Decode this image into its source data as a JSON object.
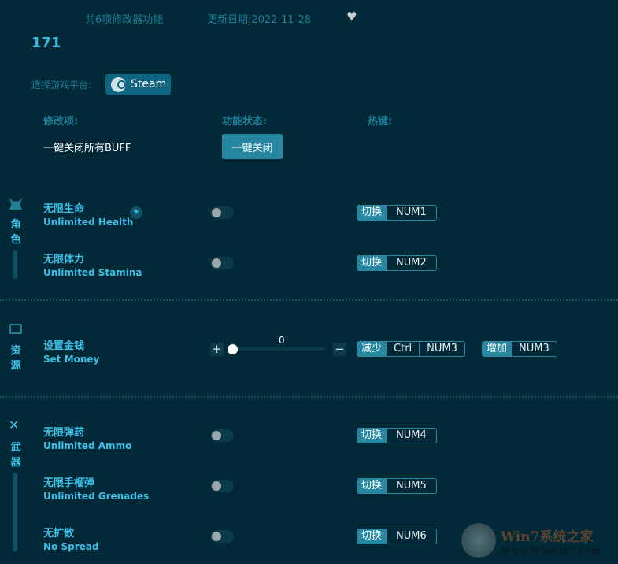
{
  "header": {
    "feature_count": "共6项修改器功能",
    "update_date": "更新日期:2022-11-28",
    "favorite_icon": "heart-icon"
  },
  "game_title": "171",
  "platform": {
    "label": "选择游戏平台:",
    "value": "Steam"
  },
  "columns": {
    "item": "修改项:",
    "status": "功能状态:",
    "hotkey": "热键:"
  },
  "close_all": {
    "label": "一键关闭所有BUFF",
    "button": "一键关闭"
  },
  "categories": [
    {
      "c1": "角",
      "c2": "色"
    },
    {
      "c1": "资",
      "c2": "源"
    },
    {
      "c1": "武",
      "c2": "器"
    }
  ],
  "items": [
    {
      "cn": "无限生命",
      "en": "Unlimited Health",
      "hk_label": "切换",
      "key": "NUM1",
      "on": false
    },
    {
      "cn": "无限体力",
      "en": "Unlimited Stamina",
      "hk_label": "切换",
      "key": "NUM2",
      "on": false
    },
    {
      "cn": "设置金钱",
      "en": "Set Money",
      "value": "0",
      "dec_label": "减少",
      "dec_mod": "Ctrl",
      "dec_key": "NUM3",
      "inc_label": "增加",
      "inc_key": "NUM3",
      "plus": "+",
      "minus": "−"
    },
    {
      "cn": "无限弹药",
      "en": "Unlimited Ammo",
      "hk_label": "切换",
      "key": "NUM4",
      "on": false
    },
    {
      "cn": "无限手榴弹",
      "en": "Unlimited Grenades",
      "hk_label": "切换",
      "key": "NUM5",
      "on": false
    },
    {
      "cn": "无扩散",
      "en": "No Spread",
      "hk_label": "切换",
      "key": "NUM6",
      "on": false
    }
  ],
  "watermark": {
    "title": "Win7系统之家",
    "url": "Www.Winwin7.com"
  }
}
